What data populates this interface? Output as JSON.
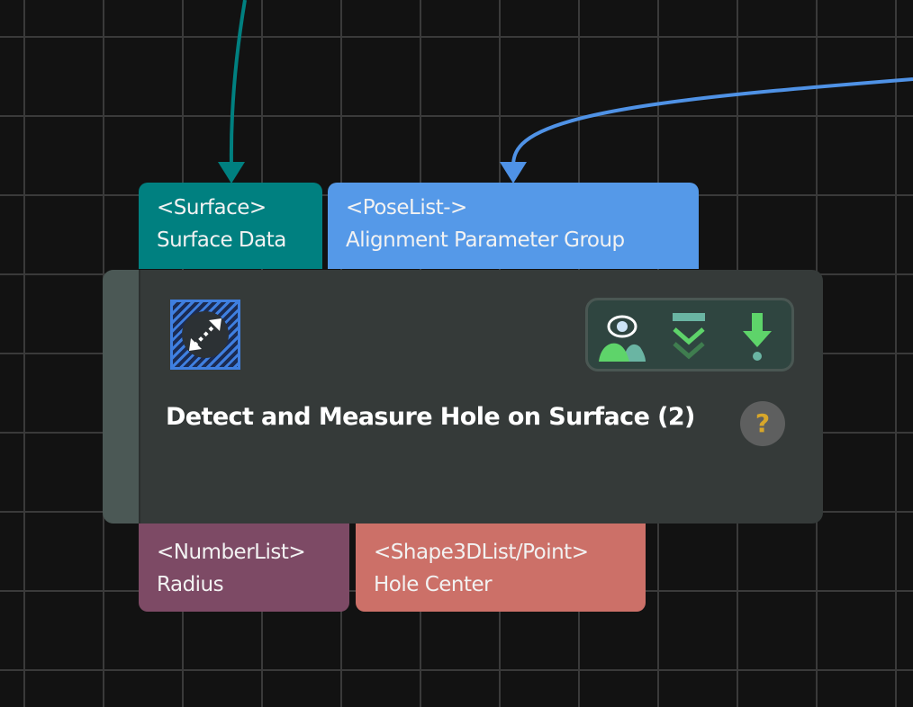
{
  "inputs": [
    {
      "type": "<Surface>",
      "label": "Surface Data",
      "color": "#008080"
    },
    {
      "type": "<PoseList->",
      "label": "Alignment Parameter Group",
      "color": "#5599e8"
    }
  ],
  "outputs": [
    {
      "type": "<NumberList>",
      "label": "Radius",
      "color": "#7d4a65"
    },
    {
      "type": "<Shape3DList/Point>",
      "label": "Hole Center",
      "color": "#cc7068"
    }
  ],
  "node": {
    "title": "Detect and Measure Hole on Surface (2)",
    "icon": "hole-measure-icon",
    "help": "?",
    "tools": [
      "view-output-icon",
      "collapse-icon",
      "debug-step-icon"
    ]
  },
  "edges": [
    {
      "color": "#008080"
    },
    {
      "color": "#4f92e6"
    }
  ]
}
